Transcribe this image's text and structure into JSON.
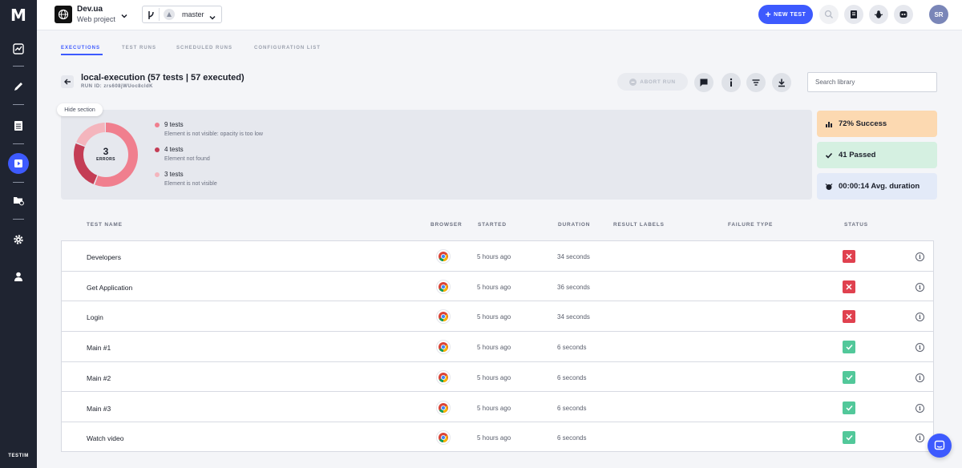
{
  "nav": {
    "logo": "M",
    "brand_bottom": "TESTIM",
    "items": [
      "dashboard-icon",
      "edit-icon",
      "list-icon",
      "runs-icon",
      "folder-settings-icon",
      "gear-icon",
      "user-icon"
    ]
  },
  "topbar": {
    "project_name": "Dev.ua",
    "project_sub": "Web project",
    "branch": "master",
    "new_test": "NEW TEST",
    "avatar": "SR"
  },
  "tabs": [
    {
      "label": "EXECUTIONS",
      "active": true
    },
    {
      "label": "TEST RUNS",
      "active": false
    },
    {
      "label": "SCHEDULED RUNS",
      "active": false
    },
    {
      "label": "CONFIGURATION LIST",
      "active": false
    }
  ],
  "run": {
    "title": "local-execution (57 tests | 57 executed)",
    "run_id": "RUN ID: zrs608jWUoc8cldK",
    "abort_label": "ABORT RUN",
    "search_placeholder": "Search library"
  },
  "summary": {
    "hide_label": "Hide section",
    "donut_count": "3",
    "donut_label": "ERRORS",
    "errors": [
      {
        "count": "9 tests",
        "desc": "Element is not visible: opacity is too low",
        "color": "#f07f8e",
        "value": 9
      },
      {
        "count": "4 tests",
        "desc": "Element not found",
        "color": "#c43d55",
        "value": 4
      },
      {
        "count": "3 tests",
        "desc": "Element is not visible",
        "color": "#f4b5bd",
        "value": 3
      }
    ],
    "stats": [
      {
        "label": "72% Success",
        "bg": "#fcd9b1",
        "icon": "bar-chart-icon"
      },
      {
        "label": "41 Passed",
        "bg": "#d5f0e1",
        "icon": "check-icon"
      },
      {
        "label": "00:00:14 Avg. duration",
        "bg": "#e3eaf8",
        "icon": "alarm-icon"
      }
    ]
  },
  "table": {
    "headers": {
      "name": "TEST NAME",
      "browser": "BROWSER",
      "started": "STARTED",
      "duration": "DURATION",
      "labels": "RESULT LABELS",
      "failure": "FAILURE TYPE",
      "status": "STATUS"
    },
    "rows": [
      {
        "name": "Developers",
        "started": "5 hours ago",
        "duration": "34 seconds",
        "status": "failed"
      },
      {
        "name": "Get Application",
        "started": "5 hours ago",
        "duration": "36 seconds",
        "status": "failed"
      },
      {
        "name": "Login",
        "started": "5 hours ago",
        "duration": "34 seconds",
        "status": "failed"
      },
      {
        "name": "Main #1",
        "started": "5 hours ago",
        "duration": "6 seconds",
        "status": "passed"
      },
      {
        "name": "Main #2",
        "started": "5 hours ago",
        "duration": "6 seconds",
        "status": "passed"
      },
      {
        "name": "Main #3",
        "started": "5 hours ago",
        "duration": "6 seconds",
        "status": "passed"
      },
      {
        "name": "Watch video",
        "started": "5 hours ago",
        "duration": "6 seconds",
        "status": "passed"
      }
    ]
  },
  "colors": {
    "accent": "#3d5afe",
    "failed": "#e0414f",
    "passed": "#52c89a"
  }
}
